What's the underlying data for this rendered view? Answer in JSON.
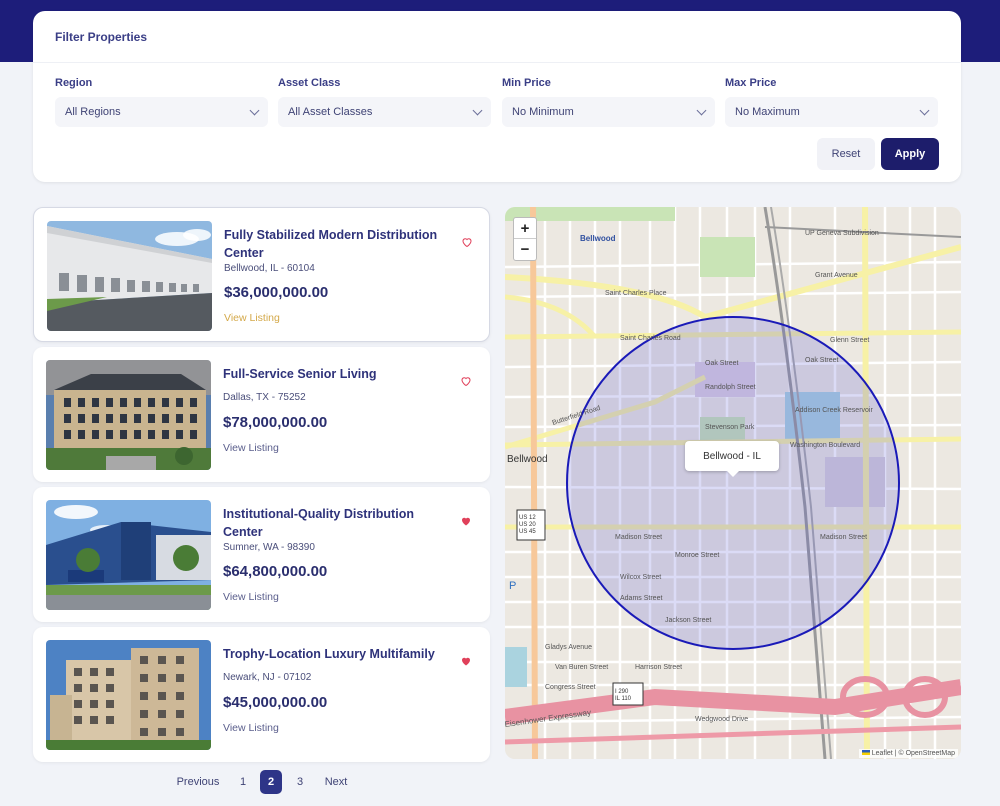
{
  "filter": {
    "title": "Filter Properties",
    "fields": [
      {
        "label": "Region",
        "value": "All Regions"
      },
      {
        "label": "Asset Class",
        "value": "All Asset Classes"
      },
      {
        "label": "Min Price",
        "value": "No Minimum"
      },
      {
        "label": "Max Price",
        "value": "No Maximum"
      }
    ],
    "reset_label": "Reset",
    "apply_label": "Apply"
  },
  "listings": [
    {
      "title": "Fully Stabilized Modern Distribution Center",
      "location": "Bellwood, IL - 60104",
      "price": "$36,000,000.00",
      "link": "View Listing",
      "favorited": false
    },
    {
      "title": "Full-Service Senior Living",
      "location": "Dallas, TX - 75252",
      "price": "$78,000,000.00",
      "link": "View Listing",
      "favorited": false
    },
    {
      "title": "Institutional-Quality Distribution Center",
      "location": "Sumner, WA - 98390",
      "price": "$64,800,000.00",
      "link": "View Listing",
      "favorited": true
    },
    {
      "title": "Trophy-Location Luxury Multifamily",
      "location": "Newark, NJ - 07102",
      "price": "$45,000,000.00",
      "link": "View Listing",
      "favorited": true
    }
  ],
  "map": {
    "zoom_in": "+",
    "zoom_out": "−",
    "tooltip": "Bellwood - IL",
    "attribution_leaflet": "Leaflet",
    "attribution_sep": " | © ",
    "attribution_osm": "OpenStreetMap",
    "labels": {
      "bellwood": "Bellwood",
      "bellwood_top": "Bellwood",
      "saint_charles_road": "Saint Charles Road",
      "saint_charles_place": "Saint Charles Place",
      "butterfield_road": "Butterfield Road",
      "washington_blvd": "Washington Boulevard",
      "madison_street": "Madison Street",
      "madison_street_2": "Madison Street",
      "oak_street": "Oak Street",
      "oak_street_2": "Oak Street",
      "grant_avenue": "Grant Avenue",
      "glenn_street": "Glenn Street",
      "randolph_street": "Randolph Street",
      "stevenson_park": "Stevenson Park",
      "addison_creek": "Addison Creek Reservoir",
      "adams_street": "Adams Street",
      "jackson_street": "Jackson Street",
      "monroe_street": "Monroe Street",
      "wilcox_street": "Wilcox Street",
      "harrison_street": "Harrison Street",
      "van_buren": "Van Buren Street",
      "congress_street": "Congress Street",
      "gladys_avenue": "Gladys Avenue",
      "wedgwood_drive": "Wedgwood Drive",
      "eisenhower": "Eisenhower Expressway",
      "up_geneva": "UP Geneva Subdivision",
      "us_shield": "US 12\nUS 20\nUS 45",
      "i290": "I 290\nIL 110",
      "p_marker": "P"
    }
  },
  "pagination": {
    "previous": "Previous",
    "pages": [
      "1",
      "2",
      "3"
    ],
    "current": "2",
    "next": "Next"
  },
  "colors": {
    "brand": "#1d1d7a",
    "apply": "#1d1d6b",
    "heart_filled": "#e0405a",
    "heart_outline": "#e0405a",
    "radius": "#1a1ab8"
  }
}
